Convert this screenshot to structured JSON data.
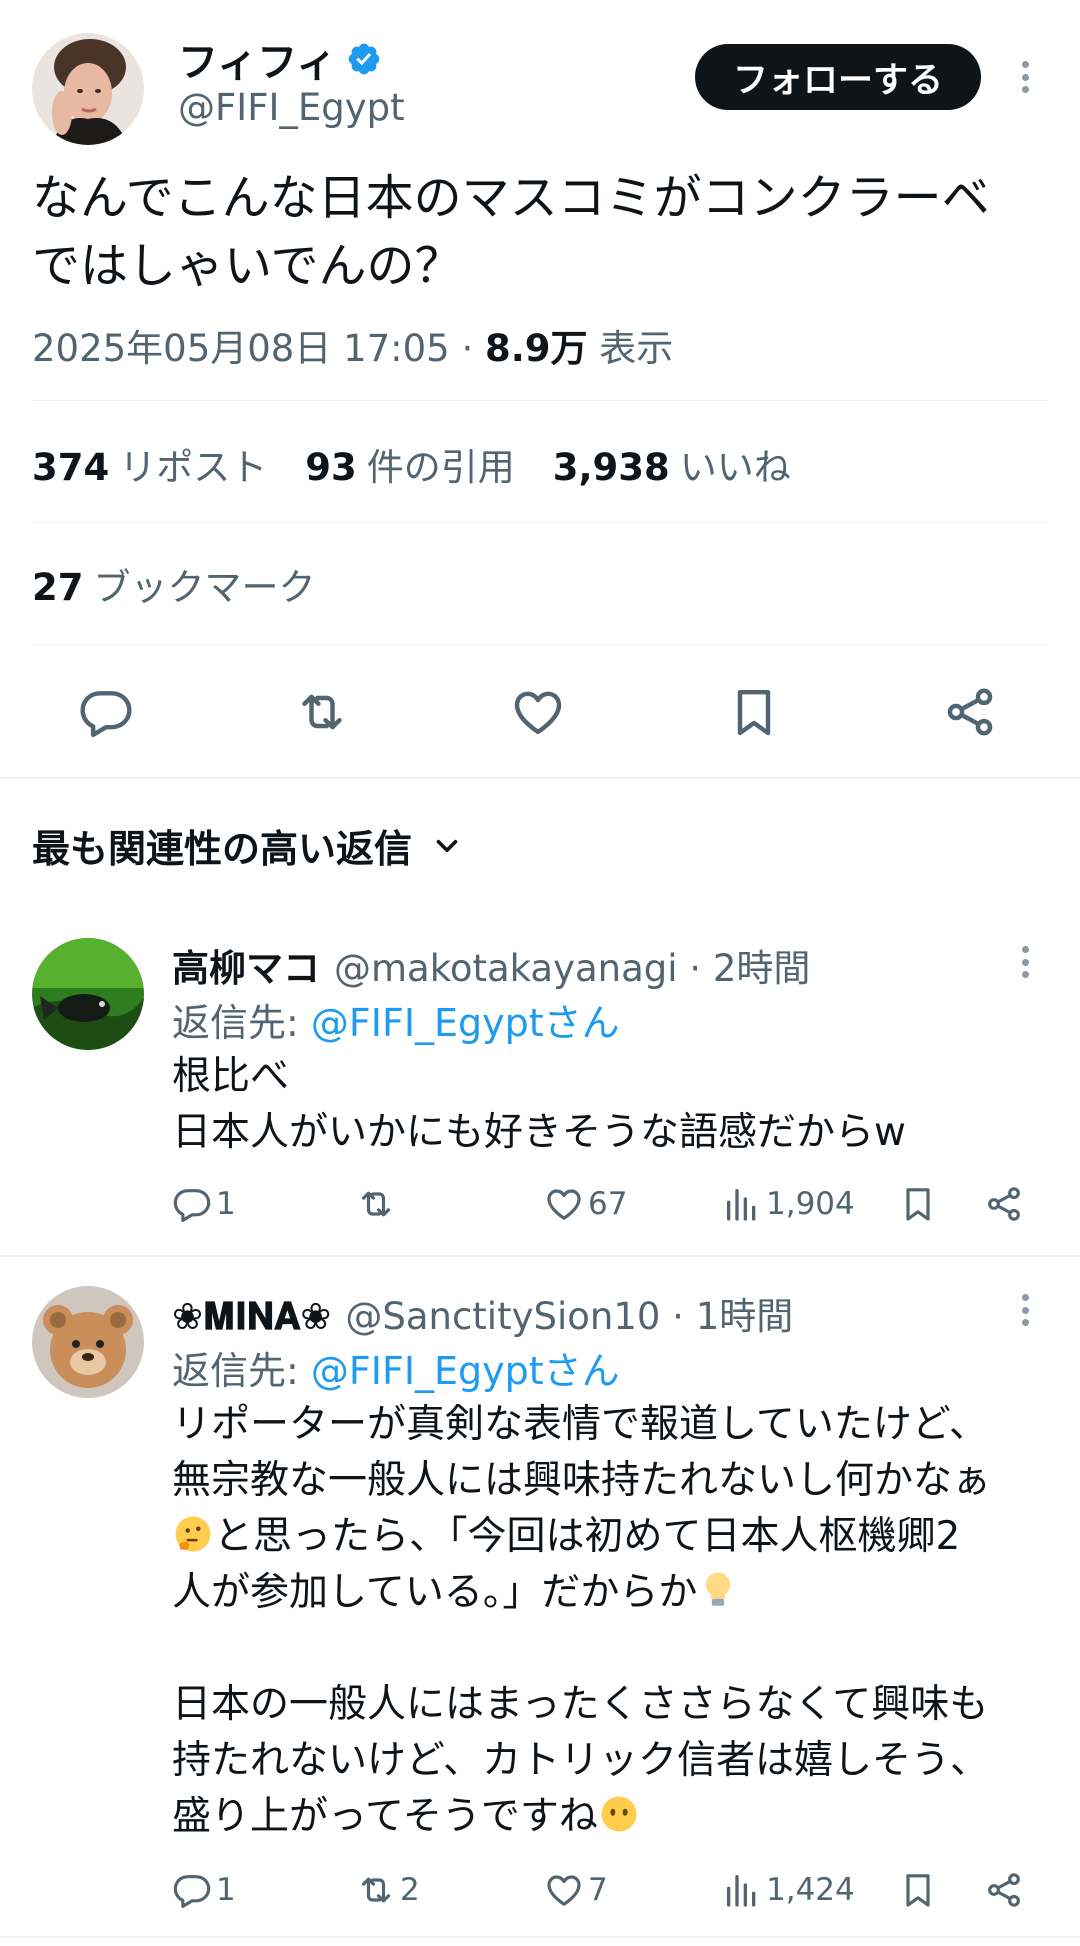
{
  "tweet": {
    "author_name": "フィフィ",
    "author_handle": "@FIFI_Egypt",
    "follow_label": "フォローする",
    "text": "なんでこんな日本のマスコミがコンクラーベ\nではしゃいでんの？",
    "timestamp": "2025年05月08日 17:05 · ",
    "views_count": "8.9万",
    "views_label": " 表示",
    "stats": {
      "reposts_count": "374",
      "reposts_label": "リポスト",
      "quotes_count": "93",
      "quotes_label": "件の引用",
      "likes_count": "3,938",
      "likes_label": "いいね",
      "bookmarks_count": "27",
      "bookmarks_label": "ブックマーク"
    }
  },
  "replies_header": "最も関連性の高い返信",
  "replies": [
    {
      "name": "高柳マコ",
      "handle": "@makotakayanagi · 2時間",
      "reply_to_prefix": "返信先: ",
      "reply_to_mention": "@FIFI_Egyptさん",
      "text": "根比べ\n日本人がいかにも好きそうな語感だからw",
      "replies": "1",
      "reposts": "",
      "likes": "67",
      "views": "1,904"
    },
    {
      "name": "❀𝐌𝐈𝐍𝐀❀",
      "handle": "@SanctitySion10 · 1時間",
      "reply_to_prefix": "返信先: ",
      "reply_to_mention": "@FIFI_Egyptさん",
      "text_part1": "リポーターが真剣な表情で報道していたけど、\n無宗教な一般人には興味持たれないし何かなぁ\n",
      "text_part2": "と思ったら、「今回は初めて日本人枢機卿2\n人が参加している。」だからか",
      "text_part3": "\n\n日本の一般人にはまったくささらなくて興味も\n持たれないけど、カトリック信者は嬉しそう、\n盛り上がってそうですね",
      "replies": "1",
      "reposts": "2",
      "likes": "7",
      "views": "1,424"
    }
  ],
  "colors": {
    "text": "#0f1419",
    "secondary": "#536471",
    "link": "#1d9bf0",
    "divider": "#eff3f4",
    "verified": "#1d9bf0"
  }
}
